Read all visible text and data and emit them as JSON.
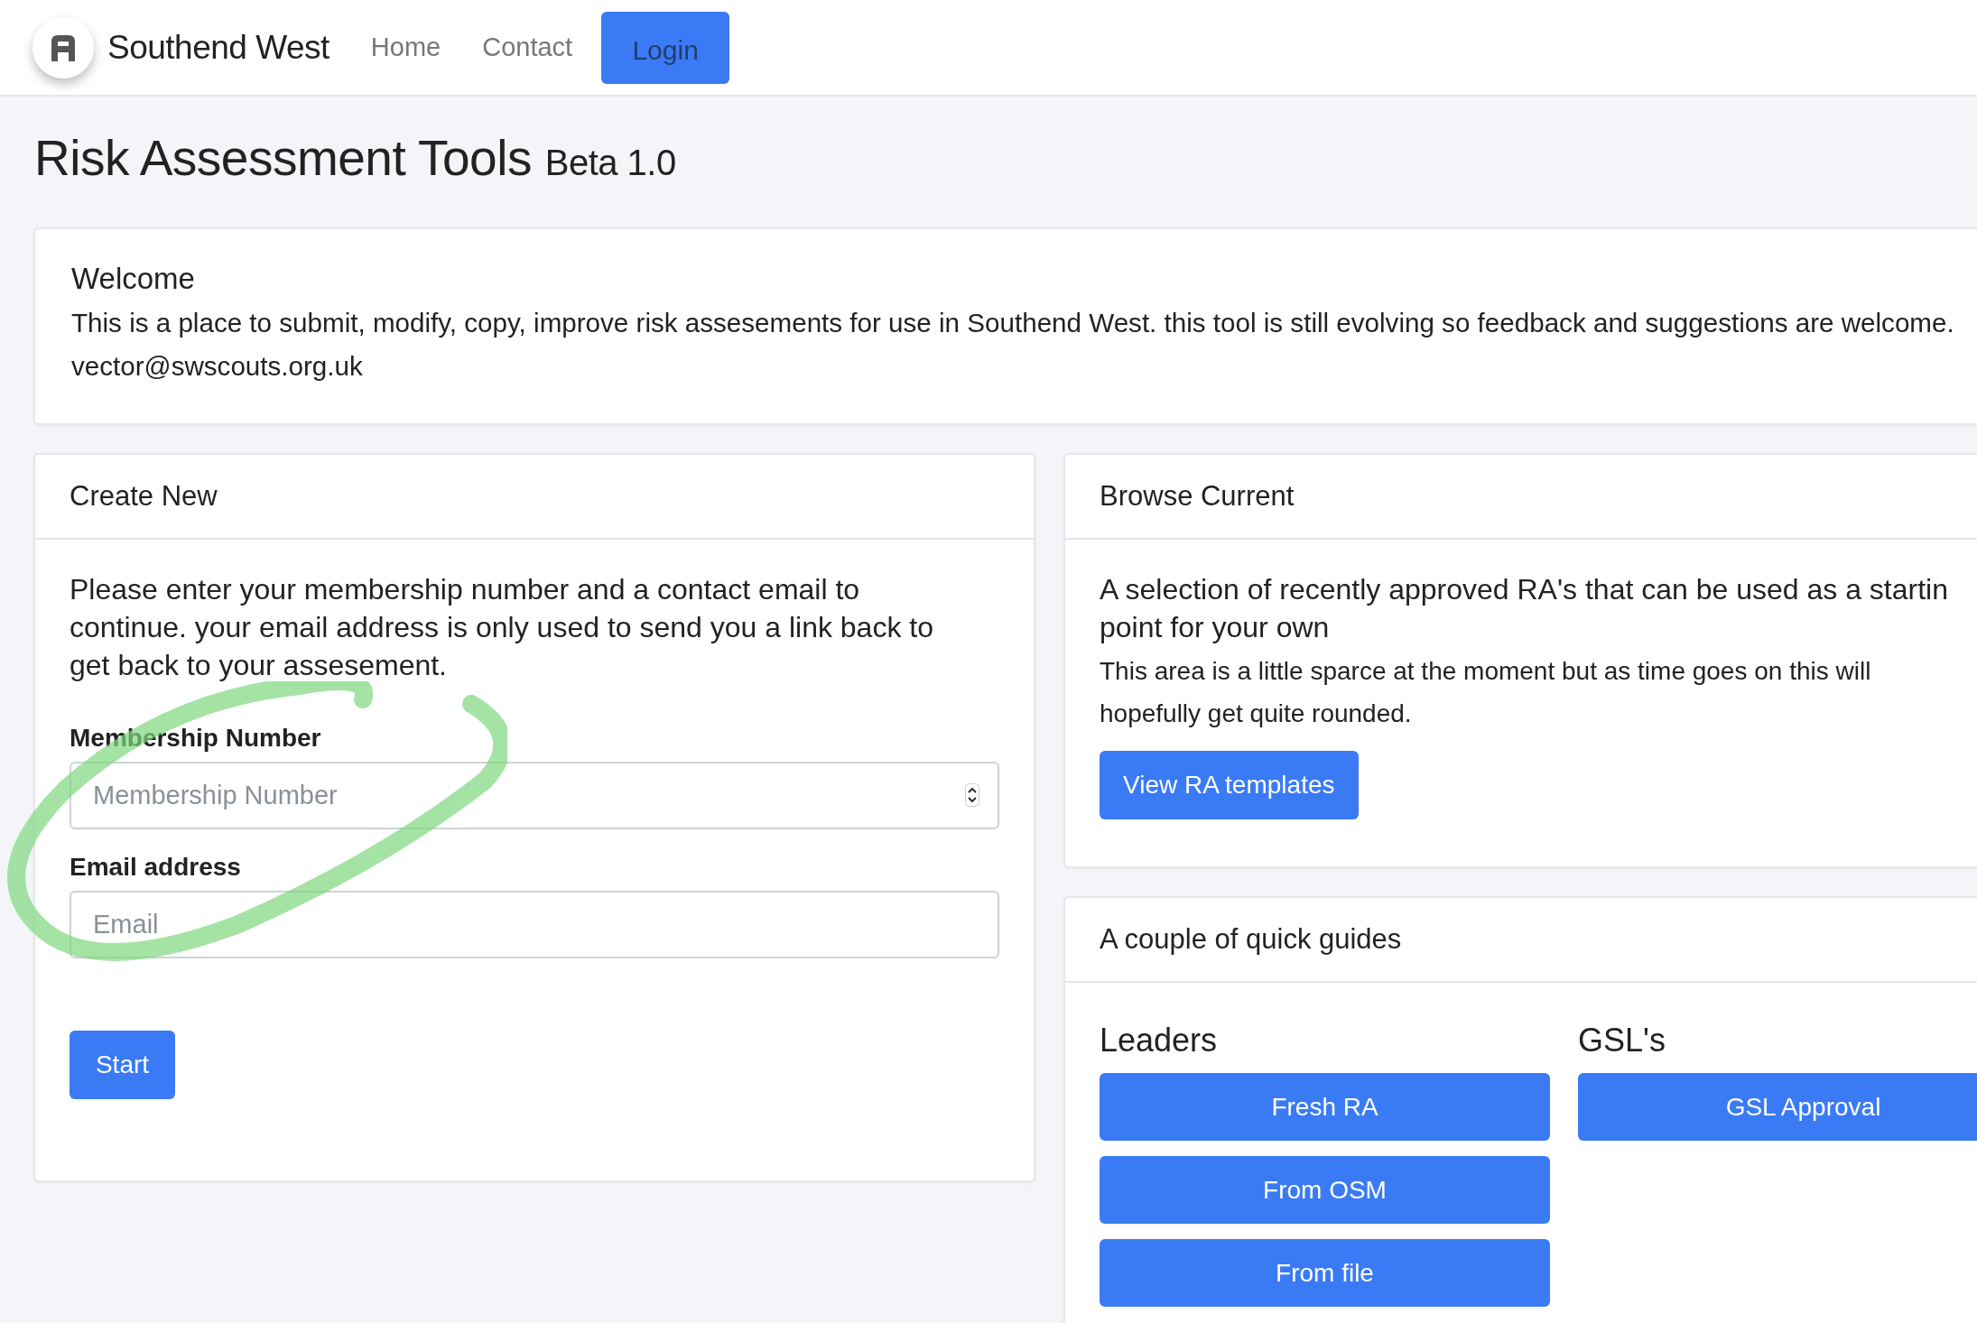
{
  "navbar": {
    "brand": "Southend West",
    "links": [
      {
        "label": "Home"
      },
      {
        "label": "Contact"
      }
    ],
    "login_button": "Login"
  },
  "page_title": {
    "main": "Risk Assessment Tools",
    "version": "Beta 1.0"
  },
  "welcome": {
    "title": "Welcome",
    "text": "This is a place to submit, modify, copy, improve risk assesements for use in Southend West. this tool is still evolving so feedback and suggestions are welcome.",
    "email": "vector@swscouts.org.uk"
  },
  "create_new": {
    "header": "Create New",
    "intro": "Please enter your membership number and a contact email to continue. your email address is only used to send you a link back to get back to your assesement.",
    "fields": [
      {
        "label": "Membership Number",
        "placeholder": "Membership Number",
        "kind": "number"
      },
      {
        "label": "Email address",
        "placeholder": "Email",
        "kind": "email"
      }
    ],
    "button": "Start"
  },
  "browse_current": {
    "header": "Browse Current",
    "lead_lines": [
      "A selection of recently approved RA's that can be used as a startin",
      "point for your own"
    ],
    "text": "This area is a little sparce at the moment but as time goes on this will hopefully get quite rounded.",
    "button": "View RA templates"
  },
  "quick_guides": {
    "header": "A couple of quick guides",
    "groups": [
      {
        "title": "Leaders",
        "buttons": [
          "Fresh RA",
          "From OSM",
          "From file"
        ]
      },
      {
        "title": "GSL's",
        "buttons": [
          "GSL Approval"
        ]
      }
    ]
  }
}
